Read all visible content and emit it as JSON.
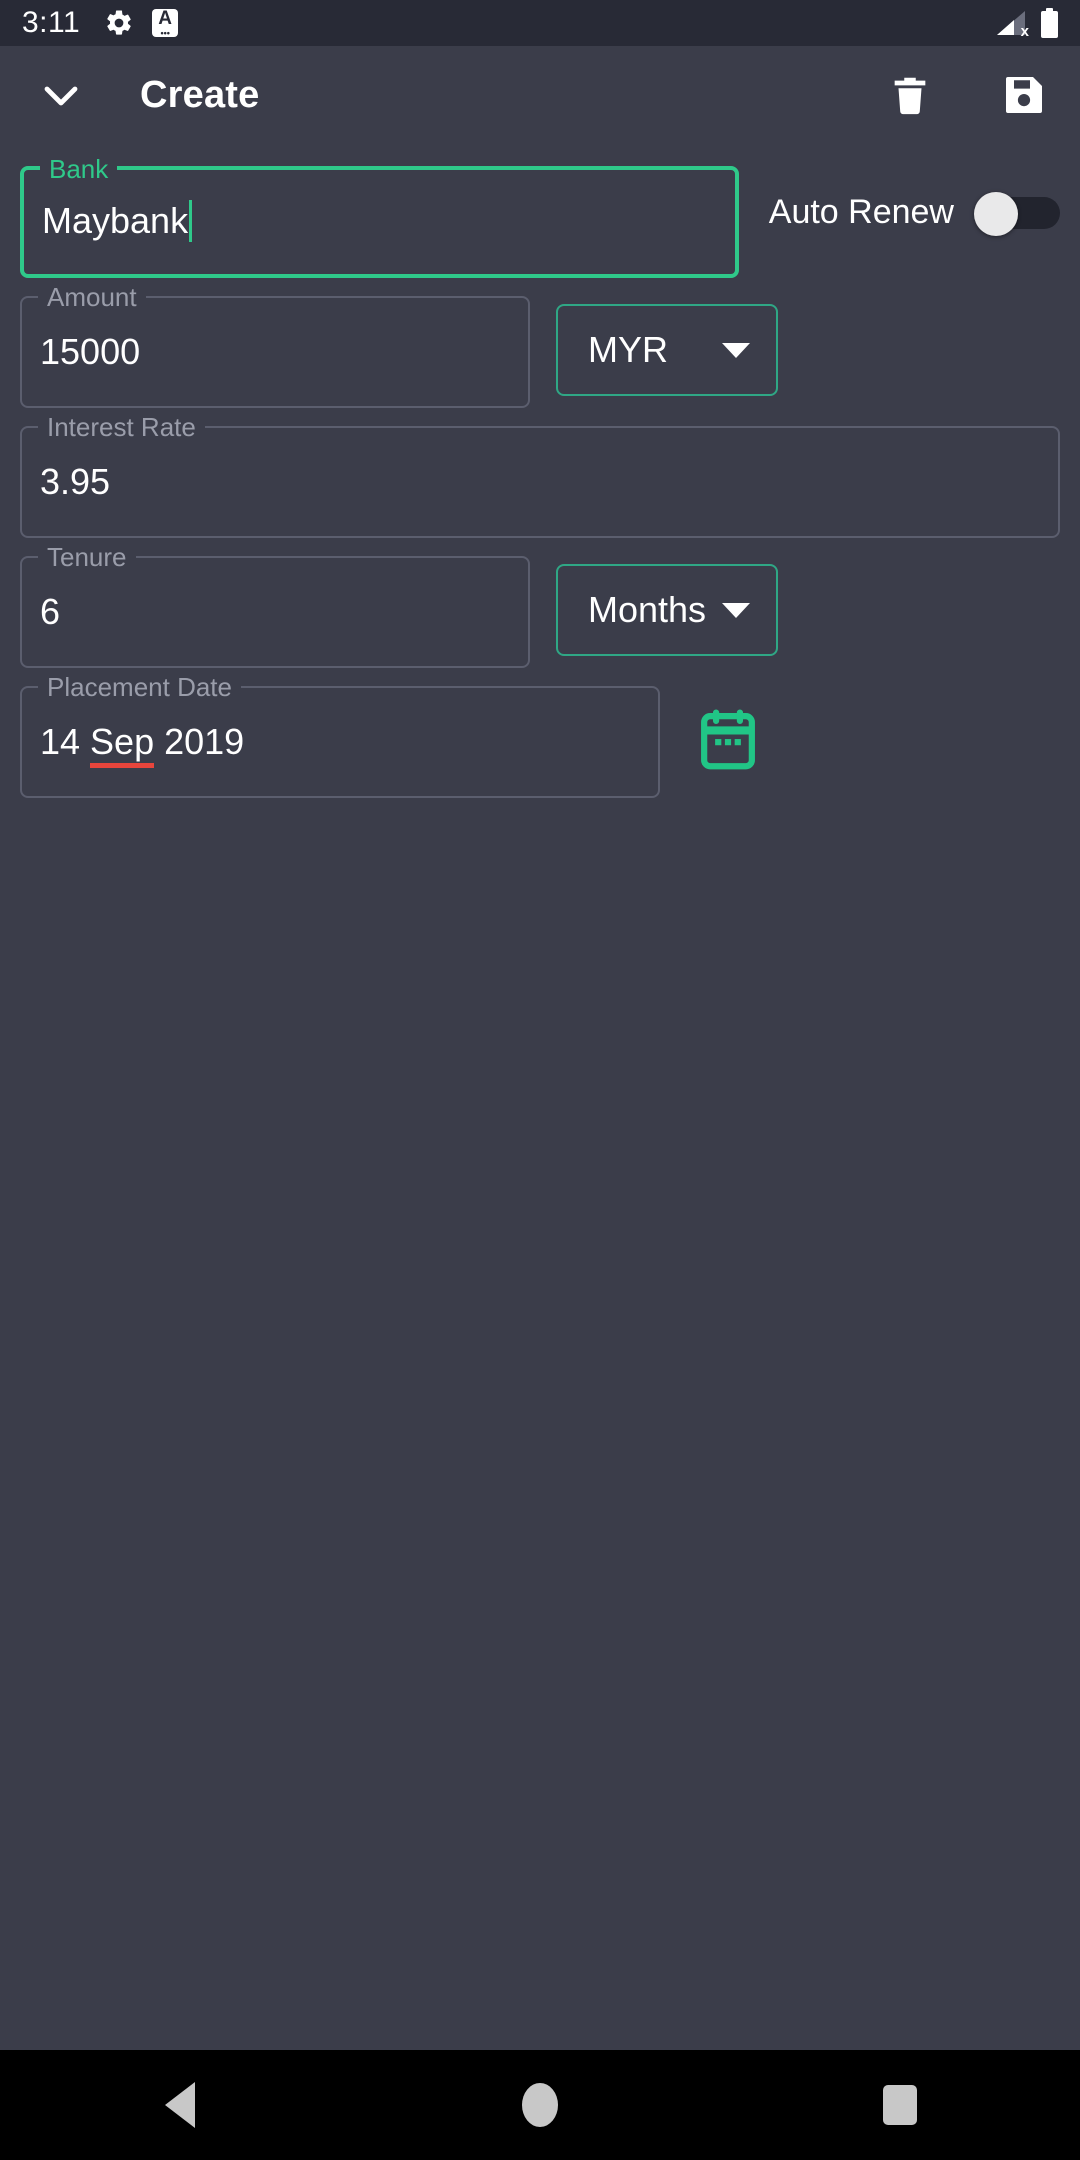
{
  "status_bar": {
    "time": "3:11",
    "settings_icon": "gear-icon",
    "input_method_icon": "A",
    "input_method_dots": "•••",
    "signal_icon": "signal-no-service-icon",
    "signal_x": "x",
    "battery_icon": "battery-full-icon"
  },
  "app_bar": {
    "nav_icon": "chevron-down-icon",
    "title": "Create",
    "delete_label": "delete-icon",
    "save_label": "save-icon"
  },
  "form": {
    "bank": {
      "label": "Bank",
      "value": "Maybank",
      "focused": true
    },
    "auto_renew": {
      "label": "Auto Renew",
      "state": "off"
    },
    "amount": {
      "label": "Amount",
      "value": "15000"
    },
    "currency": {
      "value": "MYR"
    },
    "interest_rate": {
      "label": "Interest Rate",
      "value": "3.95"
    },
    "tenure": {
      "label": "Tenure",
      "value": "6"
    },
    "tenure_unit": {
      "value": "Months"
    },
    "placement_date": {
      "label": "Placement Date",
      "value_day": "14 ",
      "value_month": "Sep",
      "value_year": " 2019",
      "calendar_icon": "calendar-icon"
    }
  },
  "nav_bar": {
    "back": "back-icon",
    "home": "home-icon",
    "recents": "recents-icon"
  },
  "colors": {
    "accent_green": "#2fc98a",
    "dropdown_border": "#2fa785",
    "background": "#3b3d4a",
    "status_bar_bg": "#282a36",
    "field_border": "#5b5e6e",
    "label_gray": "#9a9daa",
    "spellcheck_red": "#e8453c",
    "nav_bar_bg": "#000000"
  }
}
